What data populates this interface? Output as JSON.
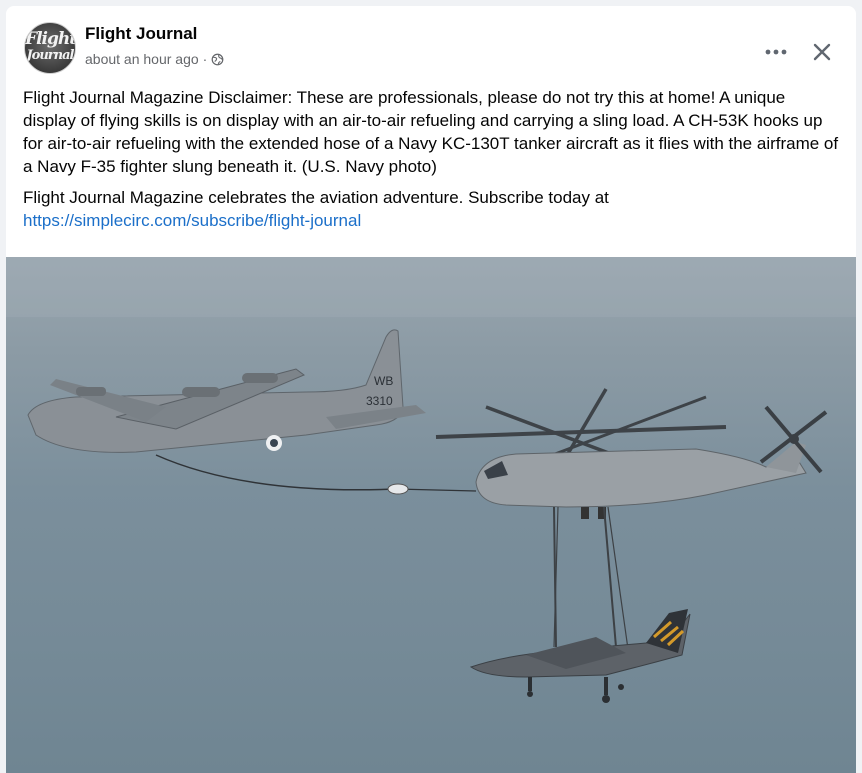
{
  "post": {
    "page_name": "Flight Journal",
    "timestamp": "about an hour ago",
    "separator": "·",
    "avatar_text_line1": "Flight",
    "avatar_text_line2": "Journal",
    "paragraph1": "Flight Journal Magazine Disclaimer: These are professionals, please do not try this at home! A unique display of flying skills is on display with an air-to-air refueling and carrying a sling load. A CH-53K hooks up for air-to-air refueling with the extended hose of a Navy KC-130T tanker aircraft as it flies with the airframe of a Navy F-35 fighter slung beneath it. (U.S. Navy photo)",
    "paragraph2": "Flight Journal Magazine celebrates the aviation adventure. Subscribe today at",
    "link": "https://simplecirc.com/subscribe/flight-journal"
  },
  "photo": {
    "tanker_tail_code": "WB",
    "tanker_tail_number": "3310"
  },
  "icons": {
    "globe": "globe-icon",
    "more": "more-horizontal-icon",
    "close": "close-icon"
  },
  "colors": {
    "link": "#1b6fc9",
    "meta": "#65676b",
    "background": "#f0f2f5"
  }
}
